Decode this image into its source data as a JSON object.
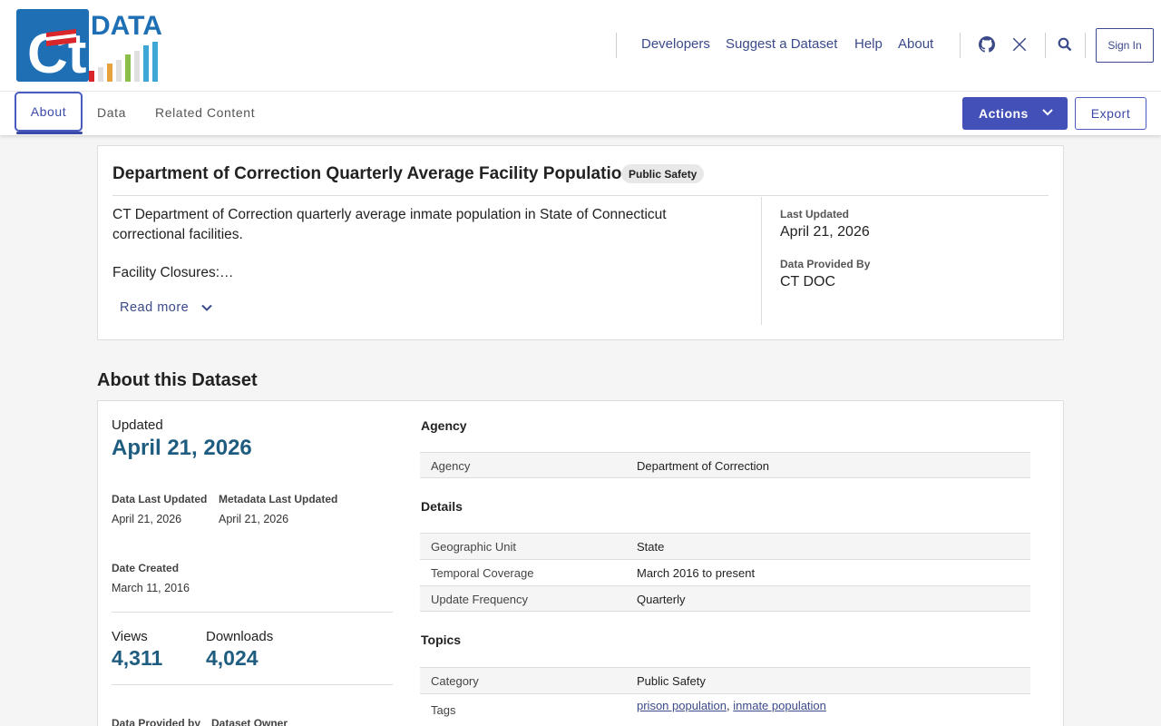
{
  "header": {
    "logo_text": "DATA",
    "logo_mark": "Ct",
    "nav": [
      "Developers",
      "Suggest a Dataset",
      "Help",
      "About"
    ],
    "icons": [
      "github-icon",
      "x-icon",
      "search-icon"
    ],
    "sign_in": "Sign In"
  },
  "tabs": {
    "items": [
      "About",
      "Data",
      "Related Content"
    ],
    "active": "About",
    "actions_label": "Actions",
    "export_label": "Export"
  },
  "summary": {
    "title": "Department of Correction Quarterly Average Facility Population",
    "category_badge": "Public Safety",
    "description": "CT Department of Correction quarterly average inmate population in State of Connecticut correctional facilities.",
    "description_more": "Facility Closures:…",
    "read_more": "Read more",
    "last_updated_label": "Last Updated",
    "last_updated": "April 21, 2026",
    "provided_by_label": "Data Provided By",
    "provided_by": "CT DOC"
  },
  "about": {
    "heading": "About this Dataset",
    "updated_label": "Updated",
    "updated": "April 21, 2026",
    "data_last_updated_label": "Data Last Updated",
    "data_last_updated": "April 21, 2026",
    "metadata_last_updated_label": "Metadata Last Updated",
    "metadata_last_updated": "April 21, 2026",
    "date_created_label": "Date Created",
    "date_created": "March 11, 2016",
    "views_label": "Views",
    "views": "4,311",
    "downloads_label": "Downloads",
    "downloads": "4,024",
    "data_provided_by_label": "Data Provided by",
    "dataset_owner_label": "Dataset Owner",
    "sections": {
      "agency": {
        "heading": "Agency",
        "rows": [
          {
            "key": "Agency",
            "value": "Department of Correction"
          }
        ]
      },
      "details": {
        "heading": "Details",
        "rows": [
          {
            "key": "Geographic Unit",
            "value": "State"
          },
          {
            "key": "Temporal Coverage",
            "value": "March 2016 to present"
          },
          {
            "key": "Update Frequency",
            "value": "Quarterly"
          }
        ]
      },
      "topics": {
        "heading": "Topics",
        "category_key": "Category",
        "category_value": "Public Safety",
        "tags_key": "Tags",
        "tags": [
          "prison population",
          "inmate population"
        ]
      }
    }
  },
  "colors": {
    "brand_blue": "#1f6fb5",
    "accent": "#4350b8",
    "link": "#3b4a8a",
    "value_blue": "#1f5d80"
  }
}
